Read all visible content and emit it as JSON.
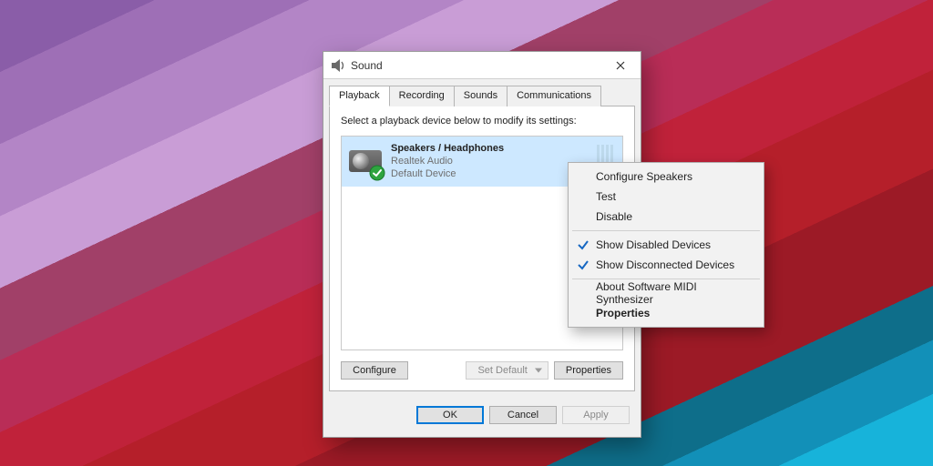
{
  "dialog": {
    "title": "Sound",
    "tabs": [
      "Playback",
      "Recording",
      "Sounds",
      "Communications"
    ],
    "active_tab": 0,
    "instruction": "Select a playback device below to modify its settings:",
    "device": {
      "name": "Speakers / Headphones",
      "driver": "Realtek Audio",
      "status": "Default Device"
    },
    "buttons": {
      "configure": "Configure",
      "set_default": "Set Default",
      "properties": "Properties",
      "ok": "OK",
      "cancel": "Cancel",
      "apply": "Apply"
    }
  },
  "context_menu": {
    "items": [
      {
        "label": "Configure Speakers",
        "checked": false,
        "bold": false
      },
      {
        "label": "Test",
        "checked": false,
        "bold": false
      },
      {
        "label": "Disable",
        "checked": false,
        "bold": false
      }
    ],
    "items2": [
      {
        "label": "Show Disabled Devices",
        "checked": true,
        "bold": false
      },
      {
        "label": "Show Disconnected Devices",
        "checked": true,
        "bold": false
      }
    ],
    "items3": [
      {
        "label": "About Software MIDI Synthesizer",
        "checked": false,
        "bold": false
      },
      {
        "label": "Properties",
        "checked": false,
        "bold": true
      }
    ]
  }
}
